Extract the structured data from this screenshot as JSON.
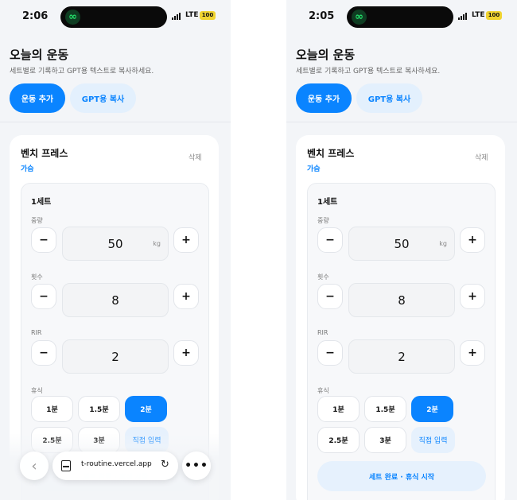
{
  "status_left": {
    "time": "2:06",
    "network": "LTE",
    "battery": "100"
  },
  "status_right": {
    "time": "2:05",
    "network": "LTE",
    "battery": "100"
  },
  "header": {
    "title": "오늘의 운동",
    "subtitle": "세트별로 기록하고 GPT용 텍스트로 복사하세요.",
    "add_label": "운동 추가",
    "copy_label": "GPT용 복사"
  },
  "exercise": {
    "name": "벤치 프레스",
    "category": "가슴",
    "delete_label": "삭제"
  },
  "set": {
    "title": "1세트",
    "weight_label": "중량",
    "weight_value": "50",
    "weight_unit": "kg",
    "reps_label": "횟수",
    "reps_value": "8",
    "rir_label": "RIR",
    "rir_value": "2",
    "minus": "−",
    "plus": "+",
    "rest_label": "휴식",
    "rest_options": [
      "1분",
      "1.5분",
      "2분",
      "2.5분",
      "3분",
      "직접 입력"
    ],
    "rest_selected": "2분",
    "complete_label": "세트 완료 · 휴식 시작"
  },
  "browser_bar": {
    "url": "t-routine.vercel.app",
    "back_glyph": "‹",
    "reload_glyph": "↻",
    "more_glyph": "•••"
  },
  "colors": {
    "accent": "#0a84ff",
    "accent_soft": "#e3f0fd",
    "background": "#f3f5f8"
  }
}
